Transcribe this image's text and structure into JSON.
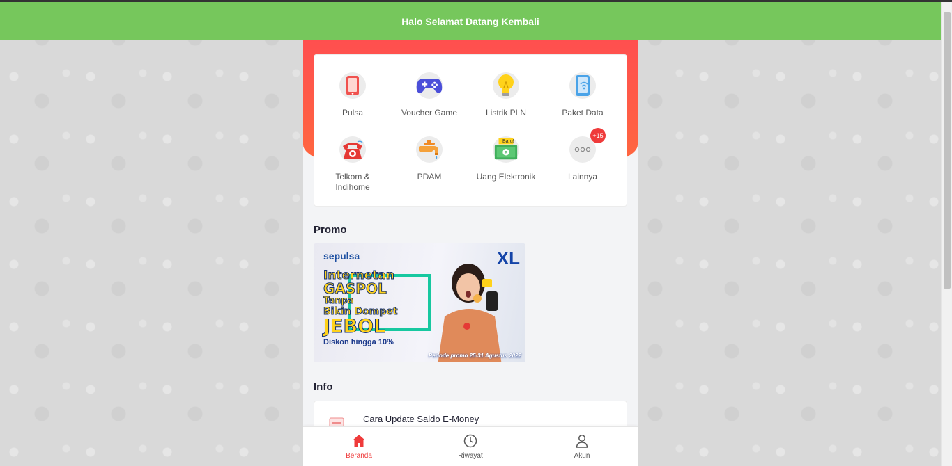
{
  "header": {
    "title": "Halo Selamat Datang Kembali"
  },
  "menu": {
    "items": [
      {
        "label": "Pulsa",
        "icon": "phone-icon"
      },
      {
        "label": "Voucher Game",
        "icon": "gamepad-icon"
      },
      {
        "label": "Listrik PLN",
        "icon": "lightbulb-icon"
      },
      {
        "label": "Paket Data",
        "icon": "mobile-data-icon"
      },
      {
        "label": "Telkom & Indihome",
        "icon": "telephone-icon"
      },
      {
        "label": "PDAM",
        "icon": "water-tap-icon"
      },
      {
        "label": "Uang Elektronik",
        "icon": "e-money-icon",
        "tag": "Baru!"
      },
      {
        "label": "Lainnya",
        "icon": "more-icon",
        "badge": "+15"
      }
    ]
  },
  "promo": {
    "title": "Promo",
    "banner": {
      "brand": "sepulsa",
      "line1": "Internetan",
      "line2": "GASPOL",
      "line3": "Tanpa",
      "line4": "Bikin Dompet",
      "line5": "JEBOL",
      "discount": "Diskon hingga 10%",
      "period": "Periode promo 25-31 Agustus 2022",
      "logo": "XL"
    }
  },
  "info": {
    "title": "Info",
    "items": [
      {
        "title": "Cara Update Saldo E-Money"
      }
    ]
  },
  "nav": {
    "items": [
      {
        "label": "Beranda",
        "icon": "home-icon",
        "active": true
      },
      {
        "label": "Riwayat",
        "icon": "clock-icon"
      },
      {
        "label": "Akun",
        "icon": "user-icon"
      }
    ]
  },
  "colors": {
    "header": "#76c75c",
    "accent": "#ef3b3b",
    "hero": "#ff4f4f"
  }
}
